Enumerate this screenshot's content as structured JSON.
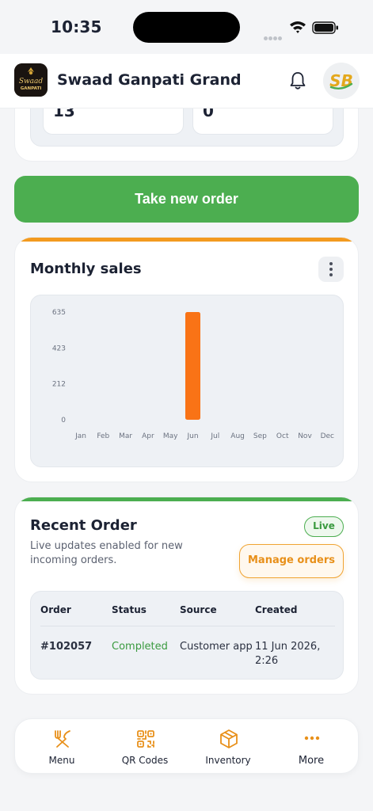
{
  "status_bar": {
    "time": "10:35"
  },
  "header": {
    "restaurant_name": "Swaad Ganpati Grand",
    "logo_text_top": "Swaad",
    "logo_text_bottom": "GANPATI",
    "avatar_text": "SB"
  },
  "stats": {
    "left_value": "13",
    "right_value": "0"
  },
  "take_order_label": "Take new order",
  "monthly_sales": {
    "title": "Monthly sales",
    "chart_data": {
      "type": "bar",
      "categories": [
        "Jan",
        "Feb",
        "Mar",
        "Apr",
        "May",
        "Jun",
        "Jul",
        "Aug",
        "Sep",
        "Oct",
        "Nov",
        "Dec"
      ],
      "values": [
        0,
        0,
        0,
        0,
        0,
        635,
        0,
        0,
        0,
        0,
        0,
        0
      ],
      "yticks": [
        "635",
        "423",
        "212",
        "0"
      ],
      "ylim": [
        0,
        635
      ],
      "bar_color": "#f97316",
      "grid": false
    }
  },
  "recent_order": {
    "title": "Recent Order",
    "live_label": "Live",
    "subtitle": "Live updates enabled for new incoming orders.",
    "manage_label": "Manage orders",
    "columns": [
      "Order",
      "Status",
      "Source",
      "Created"
    ],
    "rows": [
      {
        "order": "#102057",
        "status": "Completed",
        "source": "Customer app",
        "created": "11 Jun 2026, 2:26"
      }
    ]
  },
  "bottom_nav": {
    "items": [
      {
        "label": "Menu",
        "icon": "utensils-icon"
      },
      {
        "label": "QR Codes",
        "icon": "qr-code-icon"
      },
      {
        "label": "Inventory",
        "icon": "box-icon"
      },
      {
        "label": "More",
        "icon": "more-dots-icon"
      }
    ]
  },
  "colors": {
    "primary_green": "#4cae50",
    "accent_orange": "#f39a1f",
    "bar_orange": "#f97316"
  }
}
